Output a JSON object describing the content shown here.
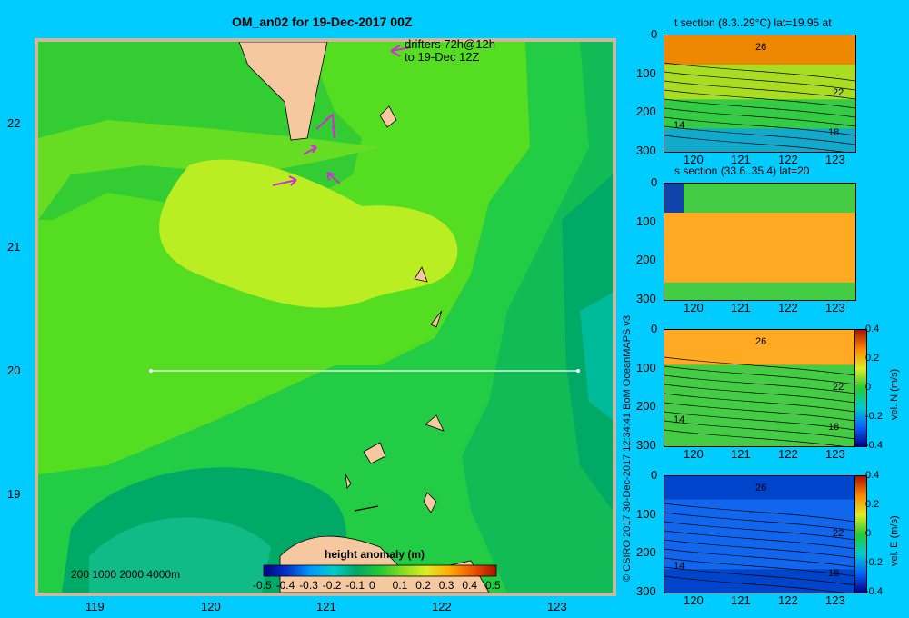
{
  "main_title": "OM_an02 for 19-Dec-2017 00Z",
  "drifter_note": [
    "drifters 72h@12h",
    "to 19-Dec 12Z"
  ],
  "credit": "© CSIRO 2017   30-Dec-2017 12:34:41 BoM OceanMAPS v3",
  "depth_legend": "200  1000  2000  4000m",
  "colorbar": {
    "label": "height anomaly (m)",
    "ticks": [
      "-0.5",
      "-0.4",
      "-0.3",
      "-0.2",
      "-0.1",
      "0",
      "0.1",
      "0.2",
      "0.3",
      "0.4",
      "0.5"
    ]
  },
  "map_axes": {
    "x_ticks": [
      "119",
      "120",
      "121",
      "122",
      "123"
    ],
    "y_ticks": [
      "22",
      "21",
      "20",
      "19"
    ]
  },
  "panels": [
    {
      "title": "t section (8.3..29°C) lat=19.95 at",
      "contour_labels": [
        "26",
        "22",
        "14",
        "18"
      ]
    },
    {
      "title": "s section (33.6..35.4) lat=20",
      "contour_labels": []
    },
    {
      "title": "",
      "contour_labels": [
        "26",
        "22",
        "14",
        "18"
      ],
      "cbar_label": "vel. N (m/s)",
      "cbar_ticks": [
        "0.4",
        "0.2",
        "0",
        "-0.2",
        "-0.4"
      ]
    },
    {
      "title": "",
      "contour_labels": [
        "26",
        "22",
        "14",
        "18"
      ],
      "cbar_label": "vel. E (m/s)",
      "cbar_ticks": [
        "0.4",
        "0.2",
        "0",
        "-0.2",
        "-0.4"
      ]
    }
  ],
  "panel_axes": {
    "x_ticks": [
      "120",
      "121",
      "122",
      "123"
    ],
    "y_ticks": [
      "0",
      "100",
      "200",
      "300"
    ]
  },
  "colors": {
    "background": "#00ccff",
    "land": "#f5c8a0",
    "shelf": "#c9b9a0",
    "drifter": "#cc33cc",
    "section_line": "#ffffff"
  },
  "chart_data": [
    {
      "type": "heatmap",
      "title": "OM_an02 for 19-Dec-2017 00Z",
      "x_range": [
        118.5,
        123.5
      ],
      "y_range": [
        18.2,
        22.7
      ],
      "colorbar_label": "height anomaly (m)",
      "colorbar_range": [
        -0.5,
        0.5
      ],
      "section_line": {
        "lat": 20.0,
        "lon_start": 119.5,
        "lon_end": 123.2
      },
      "field_levels_m": [
        0.05,
        0.1,
        0.15,
        0.2
      ]
    },
    {
      "type": "heatmap",
      "title": "t section (8.3..29°C) lat=19.95 at",
      "x_range": [
        119.6,
        123.2
      ],
      "y_range": [
        300,
        0
      ],
      "contours": [
        26,
        22,
        14,
        18
      ]
    },
    {
      "type": "heatmap",
      "title": "s section (33.6..35.4) lat=20",
      "x_range": [
        119.6,
        123.2
      ],
      "y_range": [
        300,
        0
      ]
    },
    {
      "type": "heatmap",
      "colorbar_label": "vel. N (m/s)",
      "x_range": [
        119.6,
        123.2
      ],
      "y_range": [
        300,
        0
      ],
      "colorbar_range": [
        -0.4,
        0.4
      ]
    },
    {
      "type": "heatmap",
      "colorbar_label": "vel. E (m/s)",
      "x_range": [
        119.6,
        123.2
      ],
      "y_range": [
        300,
        0
      ],
      "colorbar_range": [
        -0.4,
        0.4
      ]
    }
  ]
}
